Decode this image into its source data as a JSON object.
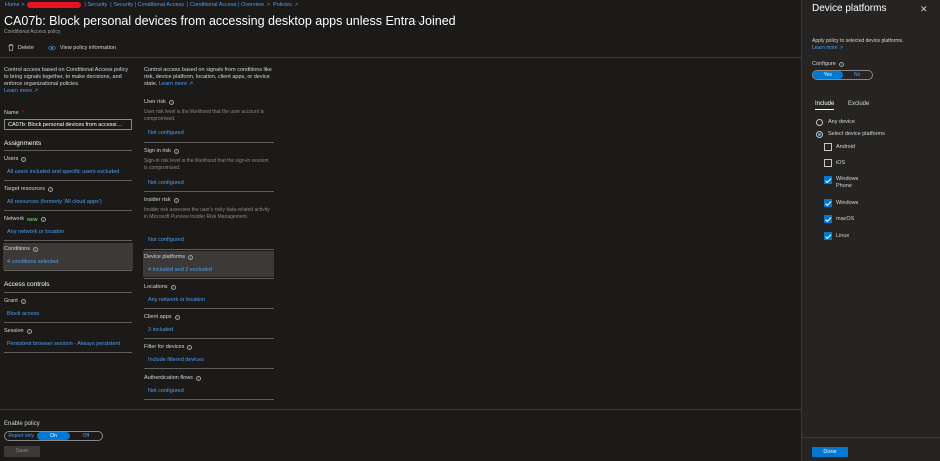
{
  "breadcrumb": {
    "items": [
      "Home >",
      "| Security",
      "| Security | Conditional Access",
      "| Conditional Access | Overview",
      ">",
      "Policies",
      ">"
    ]
  },
  "page": {
    "title": "CA07b: Block personal devices from accessing desktop apps unless Entra Joined",
    "subtitle": "Conditional Access policy",
    "more": "…"
  },
  "toolbar": {
    "delete_label": "Delete",
    "view_info_label": "View policy information"
  },
  "left": {
    "description": "Control access based on Conditional Access policy to bring signals together, to make decisions, and enforce organizational policies.",
    "learn_more": "Learn more",
    "name_label": "Name",
    "name_required": "*",
    "name_value": "CA07b: Block personal devices from accessi…",
    "assignments_heading": "Assignments",
    "users_label": "Users",
    "users_value": "All users included and specific users excluded",
    "target_label": "Target resources",
    "target_value": "All resources (formerly 'All cloud apps')",
    "network_label": "Network",
    "network_badge": "NEW",
    "network_value": "Any network or location",
    "conditions_label": "Conditions",
    "conditions_value": "4 conditions selected",
    "access_heading": "Access controls",
    "grant_label": "Grant",
    "grant_value": "Block access",
    "session_label": "Session",
    "session_value": "Persistent browser session - Always persistent"
  },
  "middle": {
    "description": "Control access based on signals from conditions like risk, device platform, location, client apps, or device state.",
    "learn_more": "Learn more",
    "user_risk_label": "User risk",
    "user_risk_desc": "User risk level is the likelihood that the user account is compromised.",
    "user_risk_value": "Not configured",
    "signin_risk_label": "Sign in risk",
    "signin_risk_desc": "Sign-in risk level is the likelihood that the sign-in session is compromised.",
    "signin_risk_value": "Not configured",
    "insider_risk_label": "Insider risk",
    "insider_risk_desc": "Insider risk assesses the user's risky data-related activity in Microsoft Purview Insider Risk Management.",
    "insider_risk_value": "Not configured",
    "device_platforms_label": "Device platforms",
    "device_platforms_value": "4 included and 2 excluded",
    "locations_label": "Locations",
    "locations_value": "Any network or location",
    "client_apps_label": "Client apps",
    "client_apps_value": "3 included",
    "filter_label": "Filter for devices",
    "filter_value": "Include filtered devices",
    "auth_flows_label": "Authentication flows",
    "auth_flows_value": "Not configured"
  },
  "bottom": {
    "enable_label": "Enable policy",
    "report_only": "Report only",
    "on": "On",
    "off": "Off",
    "save": "Save"
  },
  "panel": {
    "title": "Device platforms",
    "close": "✕",
    "apply_text": "Apply policy to selected device platforms.",
    "learn_more": "Learn more",
    "configure_label": "Configure",
    "yes": "Yes",
    "no": "No",
    "tab_include": "Include",
    "tab_exclude": "Exclude",
    "any_device": "Any device",
    "select_platforms": "Select device platforms",
    "platforms": [
      {
        "label": "Android",
        "checked": false
      },
      {
        "label": "iOS",
        "checked": false
      },
      {
        "label": "Windows Phone",
        "checked": true
      },
      {
        "label": "Windows",
        "checked": true
      },
      {
        "label": "macOS",
        "checked": true
      },
      {
        "label": "Linux",
        "checked": true
      }
    ],
    "done": "Done"
  },
  "colors": {
    "accent": "#0078d4",
    "link": "#4f9ef0",
    "background": "#1b1a19",
    "panel": "#252423",
    "redaction": "#e81123"
  }
}
